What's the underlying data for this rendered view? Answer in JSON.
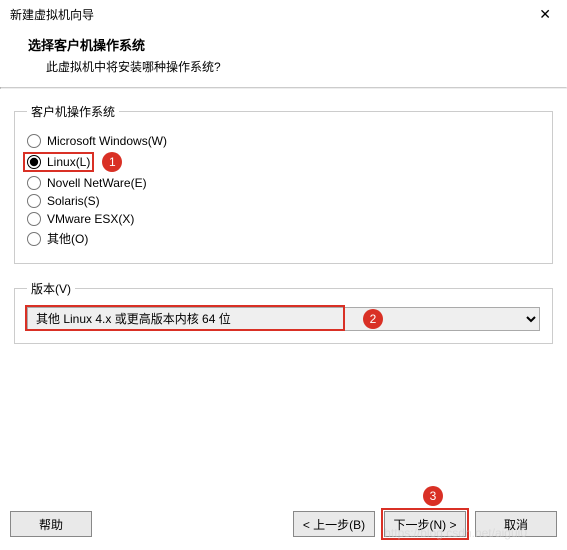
{
  "window": {
    "title": "新建虚拟机向导",
    "close": "✕"
  },
  "header": {
    "title": "选择客户机操作系统",
    "subtitle": "此虚拟机中将安装哪种操作系统?"
  },
  "os_group": {
    "legend": "客户机操作系统",
    "options": [
      {
        "label": "Microsoft Windows(W)",
        "selected": false
      },
      {
        "label": "Linux(L)",
        "selected": true
      },
      {
        "label": "Novell NetWare(E)",
        "selected": false
      },
      {
        "label": "Solaris(S)",
        "selected": false
      },
      {
        "label": "VMware ESX(X)",
        "selected": false
      },
      {
        "label": "其他(O)",
        "selected": false
      }
    ]
  },
  "version_group": {
    "legend": "版本(V)",
    "selected": "其他 Linux 4.x 或更高版本内核 64 位"
  },
  "annotations": {
    "one": "1",
    "two": "2",
    "three": "3"
  },
  "buttons": {
    "help": "帮助",
    "back": "< 上一步(B)",
    "next": "下一步(N) >",
    "cancel": "取消"
  },
  "watermark": "https://blog.csdn.net/aigui0"
}
